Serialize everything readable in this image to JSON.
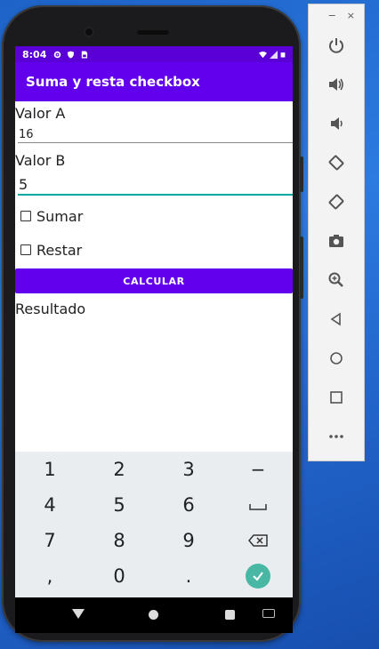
{
  "status_bar": {
    "time": "8:04",
    "left_icons": [
      "gear-icon",
      "shield-icon",
      "sim-icon"
    ],
    "right_icons": [
      "wifi-icon",
      "signal-icon",
      "battery-icon"
    ]
  },
  "app_bar": {
    "title": "Suma y resta checkbox"
  },
  "form": {
    "valor_a_label": "Valor A",
    "valor_a_value": "16",
    "valor_b_label": "Valor B",
    "valor_b_value": "5",
    "checkbox_sumar": "Sumar",
    "checkbox_restar": "Restar",
    "calcular_button": "CALCULAR",
    "result_text": "Resultado"
  },
  "keyboard": {
    "rows": [
      [
        "1",
        "2",
        "3",
        "−"
      ],
      [
        "4",
        "5",
        "6",
        "␣"
      ],
      [
        "7",
        "8",
        "9",
        "⌫"
      ],
      [
        ",",
        "0",
        ".",
        "✓"
      ]
    ],
    "accent": "#48b8a4"
  },
  "emulator_toolbar": {
    "minimize": "−",
    "close": "×",
    "buttons": [
      "power-icon",
      "volume-up-icon",
      "volume-down-icon",
      "rotate-left-icon",
      "rotate-right-icon",
      "camera-icon",
      "zoom-icon",
      "back-icon",
      "home-icon",
      "overview-icon",
      "more-icon"
    ]
  },
  "colors": {
    "app_bar": "#6200ee",
    "status_bar": "#5a00d6",
    "focus_underline": "#03a89e",
    "desktop": "#2c7be0"
  }
}
